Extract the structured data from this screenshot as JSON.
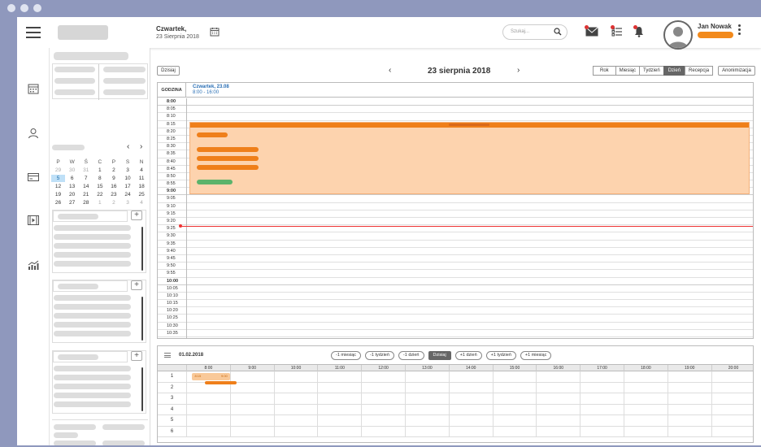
{
  "header": {
    "day_name": "Czwartek,",
    "date": "23 Sierpnia 2018",
    "search_placeholder": "Szukaj...",
    "user_name": "Jan Nowak"
  },
  "sidebar": {
    "mini_calendar": {
      "weekdays": [
        "P",
        "W",
        "Ś",
        "C",
        "P",
        "S",
        "N"
      ],
      "days": [
        {
          "d": "29",
          "dim": true
        },
        {
          "d": "30",
          "dim": true
        },
        {
          "d": "31",
          "dim": true
        },
        {
          "d": "1"
        },
        {
          "d": "2"
        },
        {
          "d": "3"
        },
        {
          "d": "4"
        },
        {
          "d": "5",
          "sel": true
        },
        {
          "d": "6"
        },
        {
          "d": "7"
        },
        {
          "d": "8"
        },
        {
          "d": "9"
        },
        {
          "d": "10"
        },
        {
          "d": "11"
        },
        {
          "d": "12"
        },
        {
          "d": "13"
        },
        {
          "d": "14"
        },
        {
          "d": "15"
        },
        {
          "d": "16"
        },
        {
          "d": "17"
        },
        {
          "d": "18"
        },
        {
          "d": "19"
        },
        {
          "d": "20"
        },
        {
          "d": "21"
        },
        {
          "d": "22"
        },
        {
          "d": "23"
        },
        {
          "d": "24"
        },
        {
          "d": "25"
        },
        {
          "d": "26"
        },
        {
          "d": "27"
        },
        {
          "d": "28"
        },
        {
          "d": "1",
          "dim": true
        },
        {
          "d": "2",
          "dim": true
        },
        {
          "d": "3",
          "dim": true
        },
        {
          "d": "4",
          "dim": true
        }
      ]
    },
    "plus_label": "+"
  },
  "toolbar": {
    "today_label": "Dzisiaj",
    "title": "23 sierpnia 2018",
    "prev": "‹",
    "next": "›",
    "views": [
      "Rok",
      "Miesiąc",
      "Tydzień",
      "Dzień",
      "Recepcja"
    ],
    "active_view": "Dzień",
    "anon_label": "Anonimizacja"
  },
  "day_view": {
    "hour_col_label": "GODZINA",
    "column_title": "Czwartek, 23.08",
    "column_hours": "8:00 - 16:00",
    "times": [
      "8:00",
      "8:05",
      "8:10",
      "8:15",
      "8:20",
      "8:25",
      "8:30",
      "8:35",
      "8:40",
      "8:45",
      "8:50",
      "8:55",
      "9:00",
      "9:05",
      "9:10",
      "9:15",
      "9:20",
      "9:25",
      "9:30",
      "9:35",
      "9:40",
      "9:45",
      "9:50",
      "9:55",
      "10:00",
      "10:05",
      "10:10",
      "10:15",
      "10:20",
      "10:25",
      "10:30",
      "10:35"
    ]
  },
  "bottom_panel": {
    "date": "01.02.2018",
    "nav_buttons": [
      "-1 miesiąc",
      "-1 tydzień",
      "-1 dzień",
      "Dzisiaj",
      "+1 dzień",
      "+1 tydzień",
      "+1 miesiąc"
    ],
    "active_button": "Dzisiaj",
    "hours": [
      "8:00",
      "9:00",
      "10:00",
      "11:00",
      "12:00",
      "13:00",
      "14:00",
      "15:00",
      "16:00",
      "17:00",
      "18:00",
      "19:00",
      "20:00"
    ],
    "rows": [
      "1",
      "2",
      "3",
      "4",
      "5",
      "6"
    ],
    "reservation": {
      "start": "8:15",
      "end": "9:00"
    }
  },
  "colors": {
    "accent": "#ef7f1a",
    "event_bg": "#fdd3ae",
    "green": "#5cb36b",
    "now_line": "#e33333",
    "frame": "#8f98bd"
  }
}
